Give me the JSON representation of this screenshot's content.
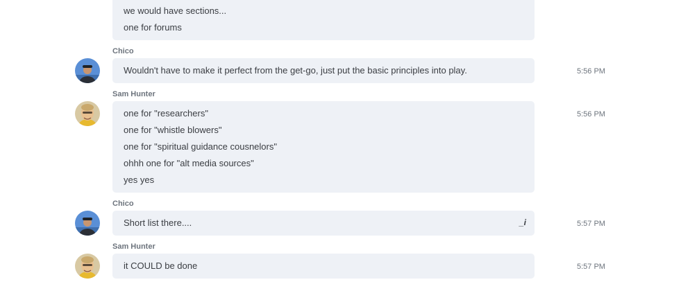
{
  "messages": [
    {
      "sender": "",
      "time": "",
      "lines": [
        "we would have sections...",
        "one for forums"
      ]
    },
    {
      "sender": "Chico",
      "time": "5:56 PM",
      "lines": [
        "Wouldn't have to make it perfect from the get-go, just put the basic principles into play."
      ]
    },
    {
      "sender": "Sam Hunter",
      "time": "5:56 PM",
      "lines": [
        "one for \"researchers\"",
        "one for \"whistle blowers\"",
        "one for \"spiritual guidance cousnelors\"",
        "ohhh one for \"alt media sources\"",
        "yes yes"
      ]
    },
    {
      "sender": "Chico",
      "time": "5:57 PM",
      "lines": [
        "Short list there...."
      ],
      "edit_mark": "_i"
    },
    {
      "sender": "Sam Hunter",
      "time": "5:57 PM",
      "lines": [
        "it COULD be done"
      ]
    }
  ],
  "avatars": {
    "chico": {
      "icon": "chico-avatar",
      "bg": "#5a8fd6"
    },
    "sam": {
      "icon": "sam-avatar",
      "bg": "#e8c85a"
    }
  },
  "colors": {
    "bubble": "#eef1f6",
    "text": "#3a3d42",
    "meta": "#6d747d"
  }
}
